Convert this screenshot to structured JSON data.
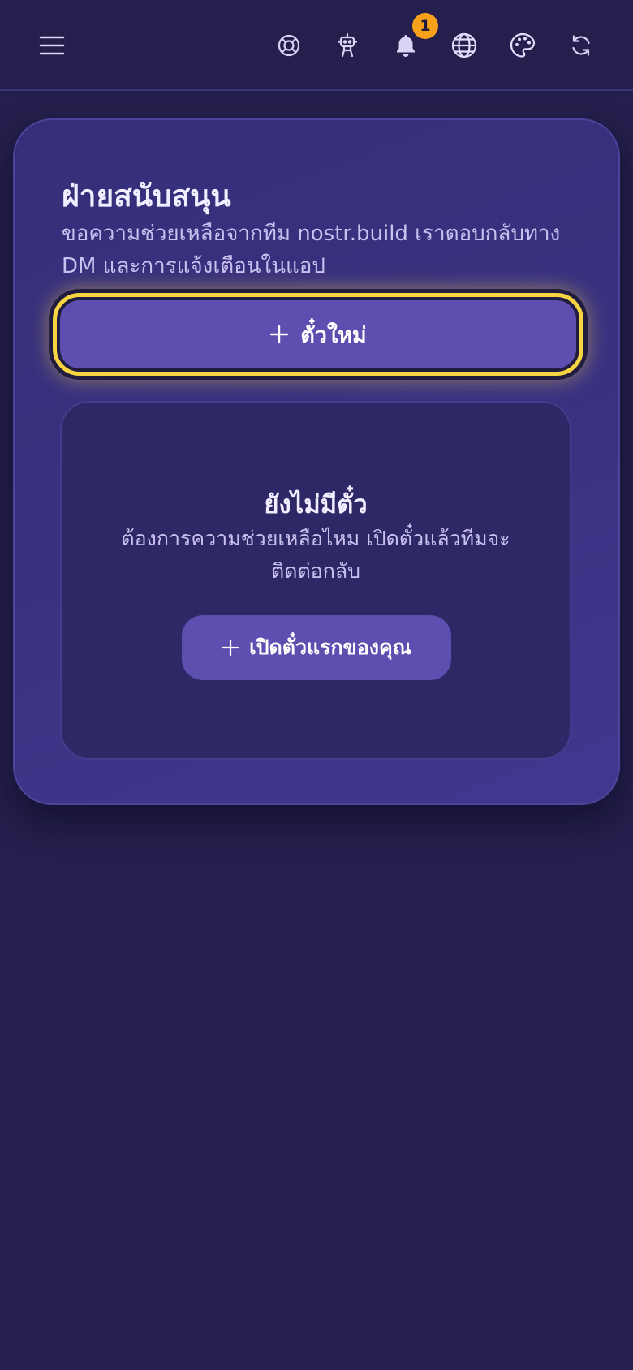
{
  "header": {
    "icons": [
      "menu-icon",
      "lifebuoy-icon",
      "robot-icon",
      "bell-icon",
      "globe-icon",
      "palette-icon",
      "refresh-icon"
    ],
    "notification_count": "1"
  },
  "support": {
    "title": "ฝ่ายสนับสนุน",
    "description": "ขอความช่วยเหลือจากทีม nostr.build เราตอบกลับทาง DM และการแจ้งเตือนในแอป",
    "new_ticket_label": "ตั๋วใหม่",
    "empty_title": "ยังไม่มีตั๋ว",
    "empty_description": "ต้องการความช่วยเหลือไหม เปิดตั๋วแล้วทีมจะติดต่อกลับ",
    "first_ticket_label": "เปิดตั๋วแรกของคุณ"
  },
  "colors": {
    "background": "#241f4c",
    "card": "#3b3382",
    "primary_button": "#5c4fb0",
    "focus_ring": "#f7d441",
    "badge": "#f7a21a"
  }
}
